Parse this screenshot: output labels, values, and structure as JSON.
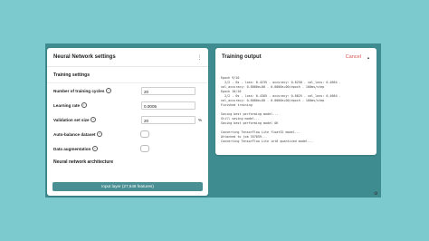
{
  "settings_panel": {
    "title": "Neural Network settings",
    "menu_icon": "more-vertical-icon",
    "training_section_title": "Training settings",
    "fields": [
      {
        "label": "Number of training cycles",
        "value": "20",
        "unit": ""
      },
      {
        "label": "Learning rate",
        "value": "0.0005",
        "unit": ""
      },
      {
        "label": "Validation set size",
        "value": "20",
        "unit": "%"
      }
    ],
    "toggles": [
      {
        "label": "Auto-balance dataset",
        "checked": false
      },
      {
        "label": "Data augmentation",
        "checked": false
      }
    ],
    "architecture_title": "Neural network architecture",
    "input_layer_button": "Input layer (27,648 features)"
  },
  "output_panel": {
    "title": "Training output",
    "cancel_label": "Cancel",
    "collapse_icon": "chevron-up-icon",
    "log_lines": [
      "Epoch 9/10",
      "  2/2 - 0s - loss: 0.4235 - accuracy: 0.8250 - val_loss: 0.4664 -",
      "val_accuracy: 0.8000e+00 - 0.0000e+00/epoch - 160ms/step",
      "Epoch 10/10",
      "  2/2 - 0s - loss: 0.4305 - accuracy: 0.8625 - val_loss: 0.4664 -",
      "val_accuracy: 0.8000e+00 - 0.0000e+00/epoch - 160ms/step",
      "Finished training",
      "",
      "Saving best performing model...",
      "Still saving model...",
      "Saving best performing model OK",
      "",
      "Converting TensorFlow Lite float32 model...",
      "Attached to job 357059...",
      "Converting TensorFlow Lite int8 quantized model..."
    ]
  },
  "footer": {
    "settings_icon": "gear-icon"
  }
}
